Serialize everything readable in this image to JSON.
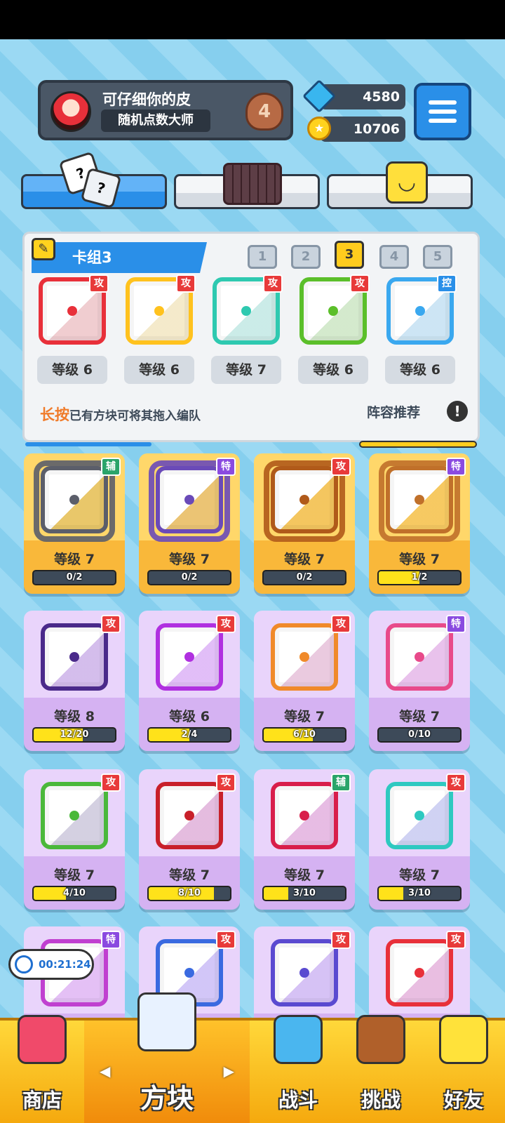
{
  "profile": {
    "name": "可仔细你的皮",
    "title": "随机点数大师",
    "rank": "4"
  },
  "currency": {
    "gems": "4580",
    "coins": "10706"
  },
  "deck": {
    "title": "卡组3",
    "numbers": [
      "1",
      "2",
      "3",
      "4",
      "5"
    ],
    "active_index": 2,
    "slots": [
      {
        "badge": "攻",
        "level": "等级 6",
        "color": "#e8303a"
      },
      {
        "badge": "攻",
        "level": "等级 6",
        "color": "#ffc21e"
      },
      {
        "badge": "攻",
        "level": "等级 7",
        "color": "#2ec9b0"
      },
      {
        "badge": "攻",
        "level": "等级 6",
        "color": "#5bbf2a"
      },
      {
        "badge": "控",
        "level": "等级 6",
        "color": "#3aa8ef"
      }
    ],
    "hint_highlight": "长按",
    "hint_rest": "已有方块可将其拖入编队",
    "recommend": "阵容推荐",
    "info_symbol": "!"
  },
  "cards": [
    {
      "badge": "辅",
      "level": "等级 7",
      "progress": "0/2",
      "ratio": 0,
      "tier": "legend",
      "color": "#5b5e6a"
    },
    {
      "badge": "特",
      "level": "等级 7",
      "progress": "0/2",
      "ratio": 0,
      "tier": "legend",
      "color": "#6a4ab8"
    },
    {
      "badge": "攻",
      "level": "等级 7",
      "progress": "0/2",
      "ratio": 0,
      "tier": "legend",
      "color": "#b05a1a"
    },
    {
      "badge": "特",
      "level": "等级 7",
      "progress": "1/2",
      "ratio": 0.5,
      "tier": "legend",
      "color": "#c0702a"
    },
    {
      "badge": "攻",
      "level": "等级 8",
      "progress": "12/20",
      "ratio": 0.6,
      "tier": "epic",
      "color": "#4a2a8a"
    },
    {
      "badge": "攻",
      "level": "等级 6",
      "progress": "2/4",
      "ratio": 0.5,
      "tier": "epic",
      "color": "#b030e0"
    },
    {
      "badge": "攻",
      "level": "等级 7",
      "progress": "6/10",
      "ratio": 0.6,
      "tier": "epic",
      "color": "#f08a2a"
    },
    {
      "badge": "特",
      "level": "等级 7",
      "progress": "0/10",
      "ratio": 0,
      "tier": "epic",
      "color": "#e84a8a"
    },
    {
      "badge": "攻",
      "level": "等级 7",
      "progress": "4/10",
      "ratio": 0.4,
      "tier": "epic",
      "color": "#4ab83a"
    },
    {
      "badge": "攻",
      "level": "等级 7",
      "progress": "8/10",
      "ratio": 0.8,
      "tier": "epic",
      "color": "#c8202a"
    },
    {
      "badge": "辅",
      "level": "等级 7",
      "progress": "3/10",
      "ratio": 0.3,
      "tier": "epic",
      "color": "#d81e4a"
    },
    {
      "badge": "攻",
      "level": "等级 7",
      "progress": "3/10",
      "ratio": 0.3,
      "tier": "epic",
      "color": "#2ec9c0"
    },
    {
      "badge": "特",
      "tier": "epic",
      "color": "#c040d0"
    },
    {
      "badge": "攻",
      "tier": "epic",
      "color": "#3a6ae0"
    },
    {
      "badge": "攻",
      "tier": "epic",
      "color": "#5a4ad0"
    },
    {
      "badge": "攻",
      "tier": "epic",
      "color": "#e8303a"
    }
  ],
  "timer": "00:21:24",
  "nav": {
    "shop": "商店",
    "blocks": "方块",
    "battle": "战斗",
    "challenge": "挑战",
    "friends": "好友",
    "left_arrow": "◀",
    "right_arrow": "▶"
  },
  "icons": {
    "pencil": "✎",
    "dice_q": "?",
    "coin": "★",
    "smile": "◡"
  }
}
